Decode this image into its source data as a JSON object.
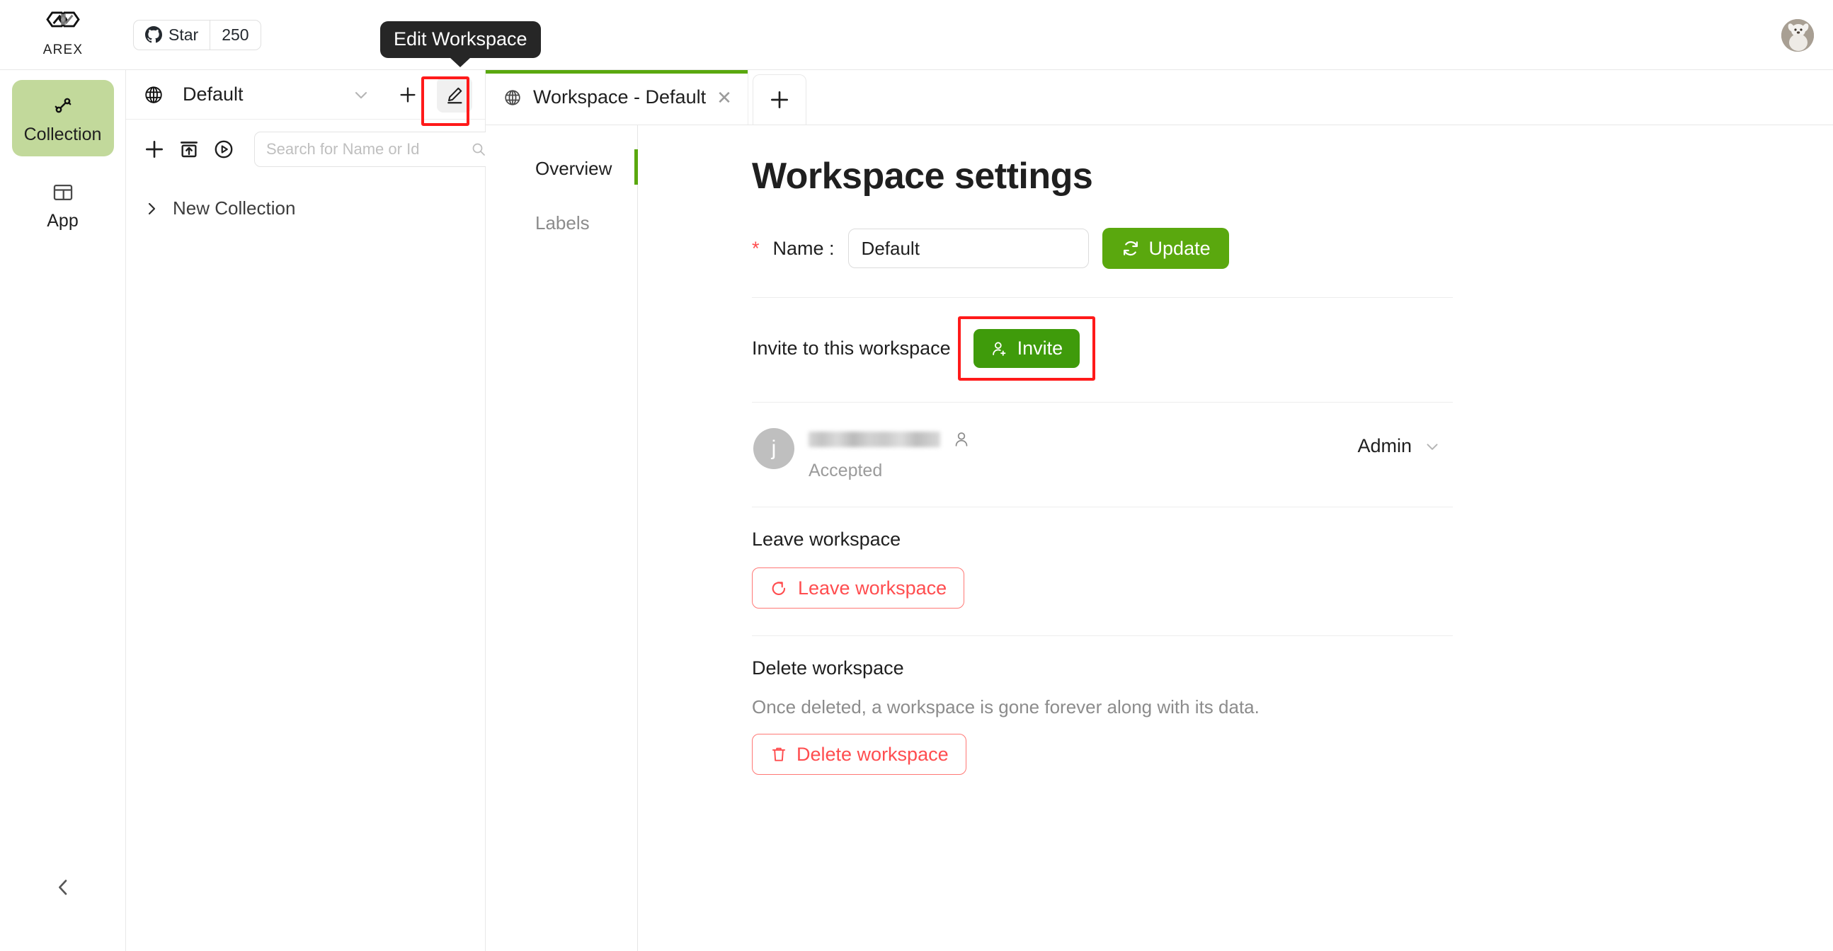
{
  "brand": {
    "name": "AREX",
    "logo_icon": "arex-logo-icon"
  },
  "github": {
    "star_label": "Star",
    "star_count": "250",
    "icon": "github-icon"
  },
  "tooltip": {
    "text": "Edit Workspace"
  },
  "rail": {
    "items": [
      {
        "label": "Collection",
        "icon": "collection-icon",
        "active": true
      },
      {
        "label": "App",
        "icon": "app-window-icon",
        "active": false
      }
    ],
    "collapse_icon": "chevron-left-icon"
  },
  "collection_panel": {
    "workspace_icon": "globe-icon",
    "workspace_name": "Default",
    "dropdown_icon": "chevron-down-icon",
    "add_icon": "plus-icon",
    "edit_icon": "pencil-edit-icon",
    "tools": [
      {
        "name": "add-icon"
      },
      {
        "name": "import-icon"
      },
      {
        "name": "run-icon"
      }
    ],
    "search": {
      "placeholder": "Search for Name or Id",
      "value": "",
      "icon": "search-icon"
    },
    "tree": [
      {
        "label": "New Collection",
        "expand_icon": "chevron-right-icon"
      }
    ]
  },
  "tabs": {
    "items": [
      {
        "label": "Workspace - Default",
        "icon": "globe-icon",
        "close_icon": "close-icon",
        "active": true
      }
    ],
    "new_tab_icon": "plus-icon"
  },
  "sidenav": {
    "items": [
      {
        "label": "Overview",
        "active": true
      },
      {
        "label": "Labels",
        "active": false
      }
    ]
  },
  "settings": {
    "title": "Workspace settings",
    "name_field": {
      "required_mark": "*",
      "label": "Name :",
      "value": "Default",
      "placeholder": "Default"
    },
    "update_button": {
      "label": "Update",
      "icon": "refresh-icon"
    },
    "invite": {
      "text": "Invite to this workspace",
      "button_label": "Invite",
      "button_icon": "user-add-icon"
    },
    "member": {
      "avatar_initial": "j",
      "name_redacted": true,
      "user_icon": "user-icon",
      "status": "Accepted",
      "role": "Admin",
      "role_chevron_icon": "chevron-down-icon"
    },
    "leave": {
      "section_title": "Leave workspace",
      "button_label": "Leave workspace",
      "button_icon": "logout-icon"
    },
    "delete": {
      "section_title": "Delete workspace",
      "description": "Once deleted, a workspace is gone forever along with its data.",
      "button_label": "Delete workspace",
      "button_icon": "trash-icon"
    }
  },
  "colors": {
    "accent_green": "#5aa80e",
    "rail_active_bg": "#c2d99b",
    "danger_red": "#ff4d4f",
    "highlight_red": "#ff1a1a"
  }
}
